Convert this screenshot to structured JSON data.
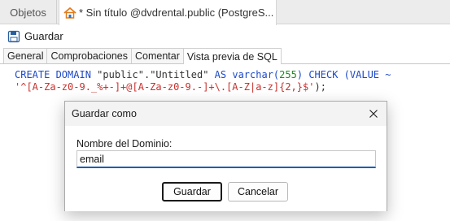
{
  "tabs": {
    "objects_label": "Objetos",
    "active_label": "* Sin título @dvdrental.public (PostgreS..."
  },
  "toolbar": {
    "save_label": "Guardar"
  },
  "subtabs": [
    {
      "label": "General"
    },
    {
      "label": "Comprobaciones"
    },
    {
      "label": "Comentar"
    },
    {
      "label": "Vista previa de SQL"
    }
  ],
  "sql": {
    "create_domain": "CREATE DOMAIN",
    "schema": "\"public\"",
    "dot": ".",
    "name": "\"Untitled\"",
    "as": "AS",
    "type": "varchar(",
    "length": "255",
    "type_close": ")",
    "check": "CHECK",
    "value_open": "(VALUE ~",
    "regex": "'^[A-Za-z0-9._%+-]+@[A-Za-z0-9.-]+\\.[A-Z|a-z]{2,}$'",
    "terminator": ");"
  },
  "dialog": {
    "title": "Guardar como",
    "field_label": "Nombre del Dominio:",
    "field_value": "email",
    "save_label": "Guardar",
    "cancel_label": "Cancelar"
  },
  "colors": {
    "keyword": "#1c49c9",
    "number": "#1e8c1e",
    "regex": "#c9302c",
    "input_focus": "#1a5fb4"
  }
}
